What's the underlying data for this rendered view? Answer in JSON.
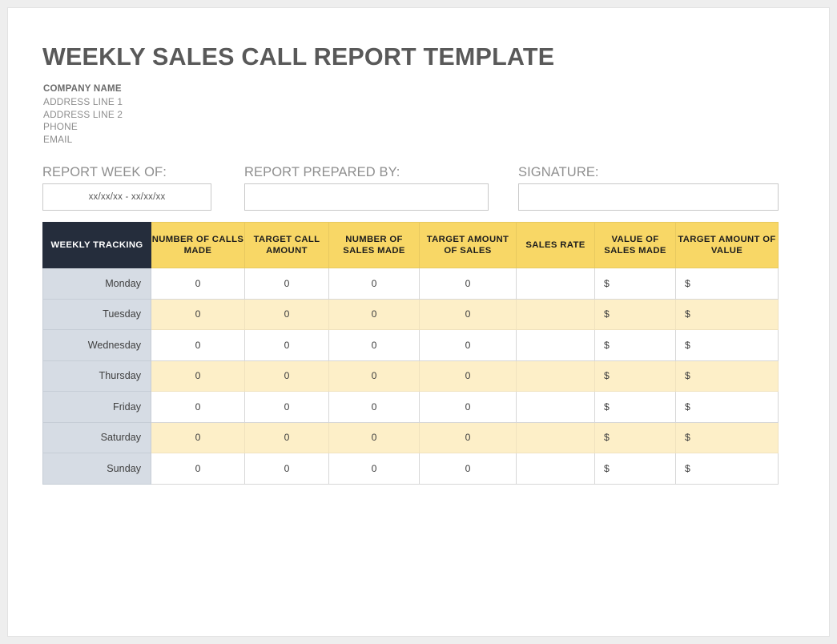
{
  "document": {
    "title": "WEEKLY SALES CALL REPORT TEMPLATE"
  },
  "company": {
    "name": "COMPANY NAME",
    "address_line_1": "ADDRESS LINE 1",
    "address_line_2": "ADDRESS LINE 2",
    "phone": "PHONE",
    "email": "EMAIL"
  },
  "fields": {
    "week": {
      "label": "REPORT WEEK OF:",
      "value": "xx/xx/xx - xx/xx/xx"
    },
    "prepared_by": {
      "label": "REPORT PREPARED BY:",
      "value": ""
    },
    "signature": {
      "label": "SIGNATURE:",
      "value": ""
    }
  },
  "table": {
    "headers": [
      "WEEKLY TRACKING",
      "NUMBER OF CALLS MADE",
      "TARGET CALL AMOUNT",
      "NUMBER OF SALES MADE",
      "TARGET AMOUNT OF SALES",
      "SALES RATE",
      "VALUE OF SALES MADE",
      "TARGET AMOUNT OF VALUE"
    ],
    "rows": [
      {
        "day": "Monday",
        "calls_made": "0",
        "target_call_amount": "0",
        "sales_made": "0",
        "target_amount_sales": "0",
        "sales_rate": "",
        "value_sales_made": "$",
        "target_amount_value": "$"
      },
      {
        "day": "Tuesday",
        "calls_made": "0",
        "target_call_amount": "0",
        "sales_made": "0",
        "target_amount_sales": "0",
        "sales_rate": "",
        "value_sales_made": "$",
        "target_amount_value": "$"
      },
      {
        "day": "Wednesday",
        "calls_made": "0",
        "target_call_amount": "0",
        "sales_made": "0",
        "target_amount_sales": "0",
        "sales_rate": "",
        "value_sales_made": "$",
        "target_amount_value": "$"
      },
      {
        "day": "Thursday",
        "calls_made": "0",
        "target_call_amount": "0",
        "sales_made": "0",
        "target_amount_sales": "0",
        "sales_rate": "",
        "value_sales_made": "$",
        "target_amount_value": "$"
      },
      {
        "day": "Friday",
        "calls_made": "0",
        "target_call_amount": "0",
        "sales_made": "0",
        "target_amount_sales": "0",
        "sales_rate": "",
        "value_sales_made": "$",
        "target_amount_value": "$"
      },
      {
        "day": "Saturday",
        "calls_made": "0",
        "target_call_amount": "0",
        "sales_made": "0",
        "target_amount_sales": "0",
        "sales_rate": "",
        "value_sales_made": "$",
        "target_amount_value": "$"
      },
      {
        "day": "Sunday",
        "calls_made": "0",
        "target_call_amount": "0",
        "sales_made": "0",
        "target_amount_sales": "0",
        "sales_rate": "",
        "value_sales_made": "$",
        "target_amount_value": "$"
      }
    ]
  },
  "colors": {
    "header_accent": "#F8D766",
    "header_corner": "#252D3C",
    "day_column": "#D6DCE4",
    "alt_row": "#FDEFC8",
    "title_text": "#595959",
    "label_text": "#8F8F8F"
  }
}
